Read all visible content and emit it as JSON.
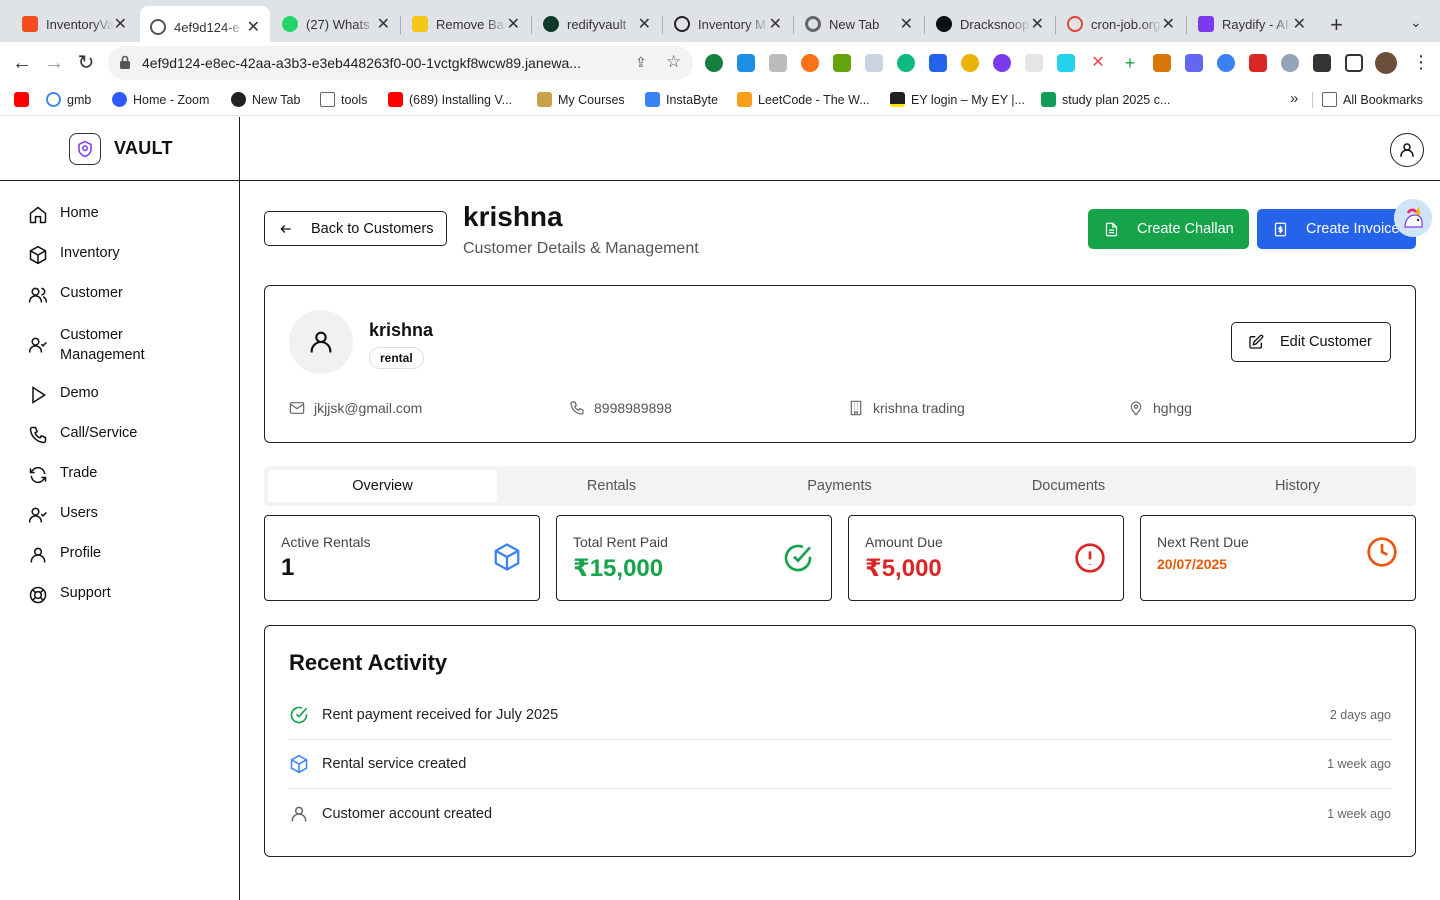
{
  "browser": {
    "tabs": [
      {
        "title": "InventoryVa",
        "icon": "figma-icon",
        "color": "#f24e1e"
      },
      {
        "title": "4ef9d124-e",
        "icon": "globe-icon",
        "color": "#555555"
      },
      {
        "title": "(27) Whats",
        "icon": "whatsapp-icon",
        "color": "#25d366"
      },
      {
        "title": "Remove Ba",
        "icon": "remove-bg-icon",
        "color": "#f5c518"
      },
      {
        "title": "redifyvault",
        "icon": "mongodb-icon",
        "color": "#0d3a2b"
      },
      {
        "title": "Inventory M",
        "icon": "openai-icon",
        "color": "#222222"
      },
      {
        "title": "New Tab",
        "icon": "chrome-icon",
        "color": "#666666"
      },
      {
        "title": "Dracksnoop",
        "icon": "github-icon",
        "color": "#111111"
      },
      {
        "title": "cron-job.org",
        "icon": "cron-icon",
        "color": "#e14434"
      },
      {
        "title": "Raydify - AI",
        "icon": "raydify-icon",
        "color": "#7c3aed"
      }
    ],
    "url": "4ef9d124-e8ec-42aa-a3b3-e3eb448263f0-00-1vctgkf8wcw89.janewa...",
    "bookmarks": [
      {
        "label": "",
        "icon": "youtube-icon",
        "color": "#ff0000"
      },
      {
        "label": "gmb",
        "icon": "google-icon",
        "color": "#4285f4"
      },
      {
        "label": "Home - Zoom",
        "icon": "zoom-icon",
        "color": "#2d5bff"
      },
      {
        "label": "New Tab",
        "icon": "openai-icon",
        "color": "#222222"
      },
      {
        "label": "tools",
        "icon": "folder-icon",
        "color": "#666666"
      },
      {
        "label": "(689) Installing V...",
        "icon": "youtube-icon",
        "color": "#ff0000"
      },
      {
        "label": "My Courses",
        "icon": "courses-icon",
        "color": "#c8a24a"
      },
      {
        "label": "InstaByte",
        "icon": "instabyte-icon",
        "color": "#3b82f6"
      },
      {
        "label": "LeetCode - The W...",
        "icon": "leetcode-icon",
        "color": "#f89f1b"
      },
      {
        "label": "EY login – My EY |...",
        "icon": "ey-icon",
        "color": "#ffe600"
      },
      {
        "label": "study plan 2025 c...",
        "icon": "sheets-icon",
        "color": "#0f9d58"
      }
    ],
    "all_bookmarks": "All Bookmarks"
  },
  "app": {
    "brand": "VAULT",
    "nav": [
      {
        "label": "Home",
        "icon": "home-icon"
      },
      {
        "label": "Inventory",
        "icon": "box-icon"
      },
      {
        "label": "Customer",
        "icon": "users-icon"
      },
      {
        "label": "Customer Management",
        "icon": "user-check-icon"
      },
      {
        "label": "Demo",
        "icon": "play-icon"
      },
      {
        "label": "Call/Service",
        "icon": "phone-icon"
      },
      {
        "label": "Trade",
        "icon": "refresh-icon"
      },
      {
        "label": "Users",
        "icon": "user-check-icon"
      },
      {
        "label": "Profile",
        "icon": "user-icon"
      },
      {
        "label": "Support",
        "icon": "lifebuoy-icon"
      }
    ]
  },
  "page": {
    "back_label": "Back to Customers",
    "title": "krishna",
    "subtitle": "Customer Details & Management",
    "create_challan": "Create Challan",
    "create_invoice": "Create Invoice"
  },
  "customer": {
    "name": "krishna",
    "type": "rental",
    "edit_label": "Edit Customer",
    "email": "jkjjsk@gmail.com",
    "phone": "8998989898",
    "company": "krishna trading",
    "location": "hghgg"
  },
  "tabs": [
    "Overview",
    "Rentals",
    "Payments",
    "Documents",
    "History"
  ],
  "stats": [
    {
      "label": "Active Rentals",
      "value": "1",
      "color": "#111111",
      "icon": "box-icon",
      "icon_color": "#3b82f6"
    },
    {
      "label": "Total Rent Paid",
      "value": "₹15,000",
      "color": "#16a34a",
      "icon": "check-circle-icon",
      "icon_color": "#16a34a"
    },
    {
      "label": "Amount Due",
      "value": "₹5,000",
      "color": "#dc2626",
      "icon": "alert-circle-icon",
      "icon_color": "#dc2626"
    },
    {
      "label": "Next Rent Due",
      "value": "20/07/2025",
      "color": "#ea580c",
      "icon": "clock-icon",
      "icon_color": "#ea580c"
    }
  ],
  "activity": {
    "title": "Recent Activity",
    "items": [
      {
        "text": "Rent payment received for July 2025",
        "time": "2 days ago",
        "icon": "check-circle-icon",
        "color": "#16a34a"
      },
      {
        "text": "Rental service created",
        "time": "1 week ago",
        "icon": "box-icon",
        "color": "#3b82f6"
      },
      {
        "text": "Customer account created",
        "time": "1 week ago",
        "icon": "user-icon",
        "color": "#666666"
      }
    ]
  }
}
